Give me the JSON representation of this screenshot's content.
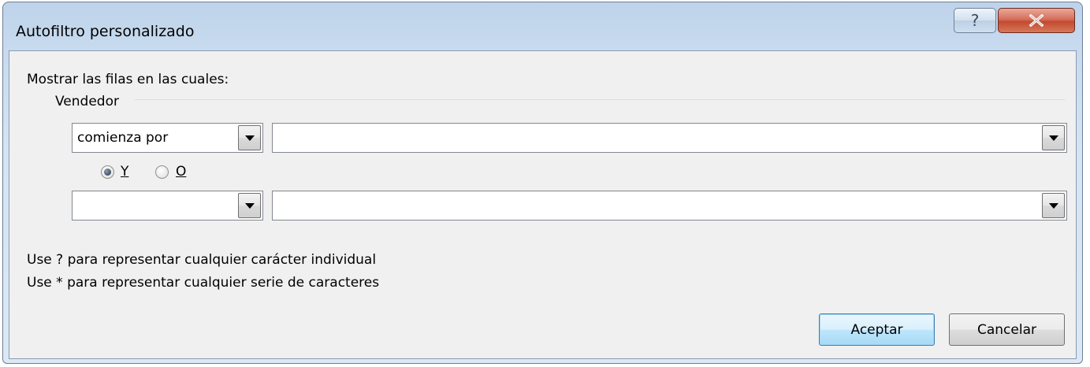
{
  "window": {
    "title": "Autofiltro personalizado",
    "help_glyph": "?",
    "close_glyph": "X"
  },
  "filter": {
    "prompt": "Mostrar las filas en las cuales:",
    "field_name": "Vendedor",
    "condition1": {
      "operator": "comienza por",
      "value": ""
    },
    "logic": {
      "and_label": "Y",
      "or_label": "O",
      "selected": "Y"
    },
    "condition2": {
      "operator": "",
      "value": ""
    },
    "hint1": "Use ? para representar cualquier carácter individual",
    "hint2": "Use * para representar cualquier serie de caracteres"
  },
  "buttons": {
    "ok": "Aceptar",
    "cancel": "Cancelar"
  },
  "icons": [
    "help-icon",
    "close-icon",
    "dropdown-arrow-icon",
    "radio-icon"
  ],
  "colors": {
    "titlebar": "#c7daee",
    "client": "#f0f0f0",
    "close_button": "#c24a30",
    "default_button_border": "#3c7fb1"
  }
}
